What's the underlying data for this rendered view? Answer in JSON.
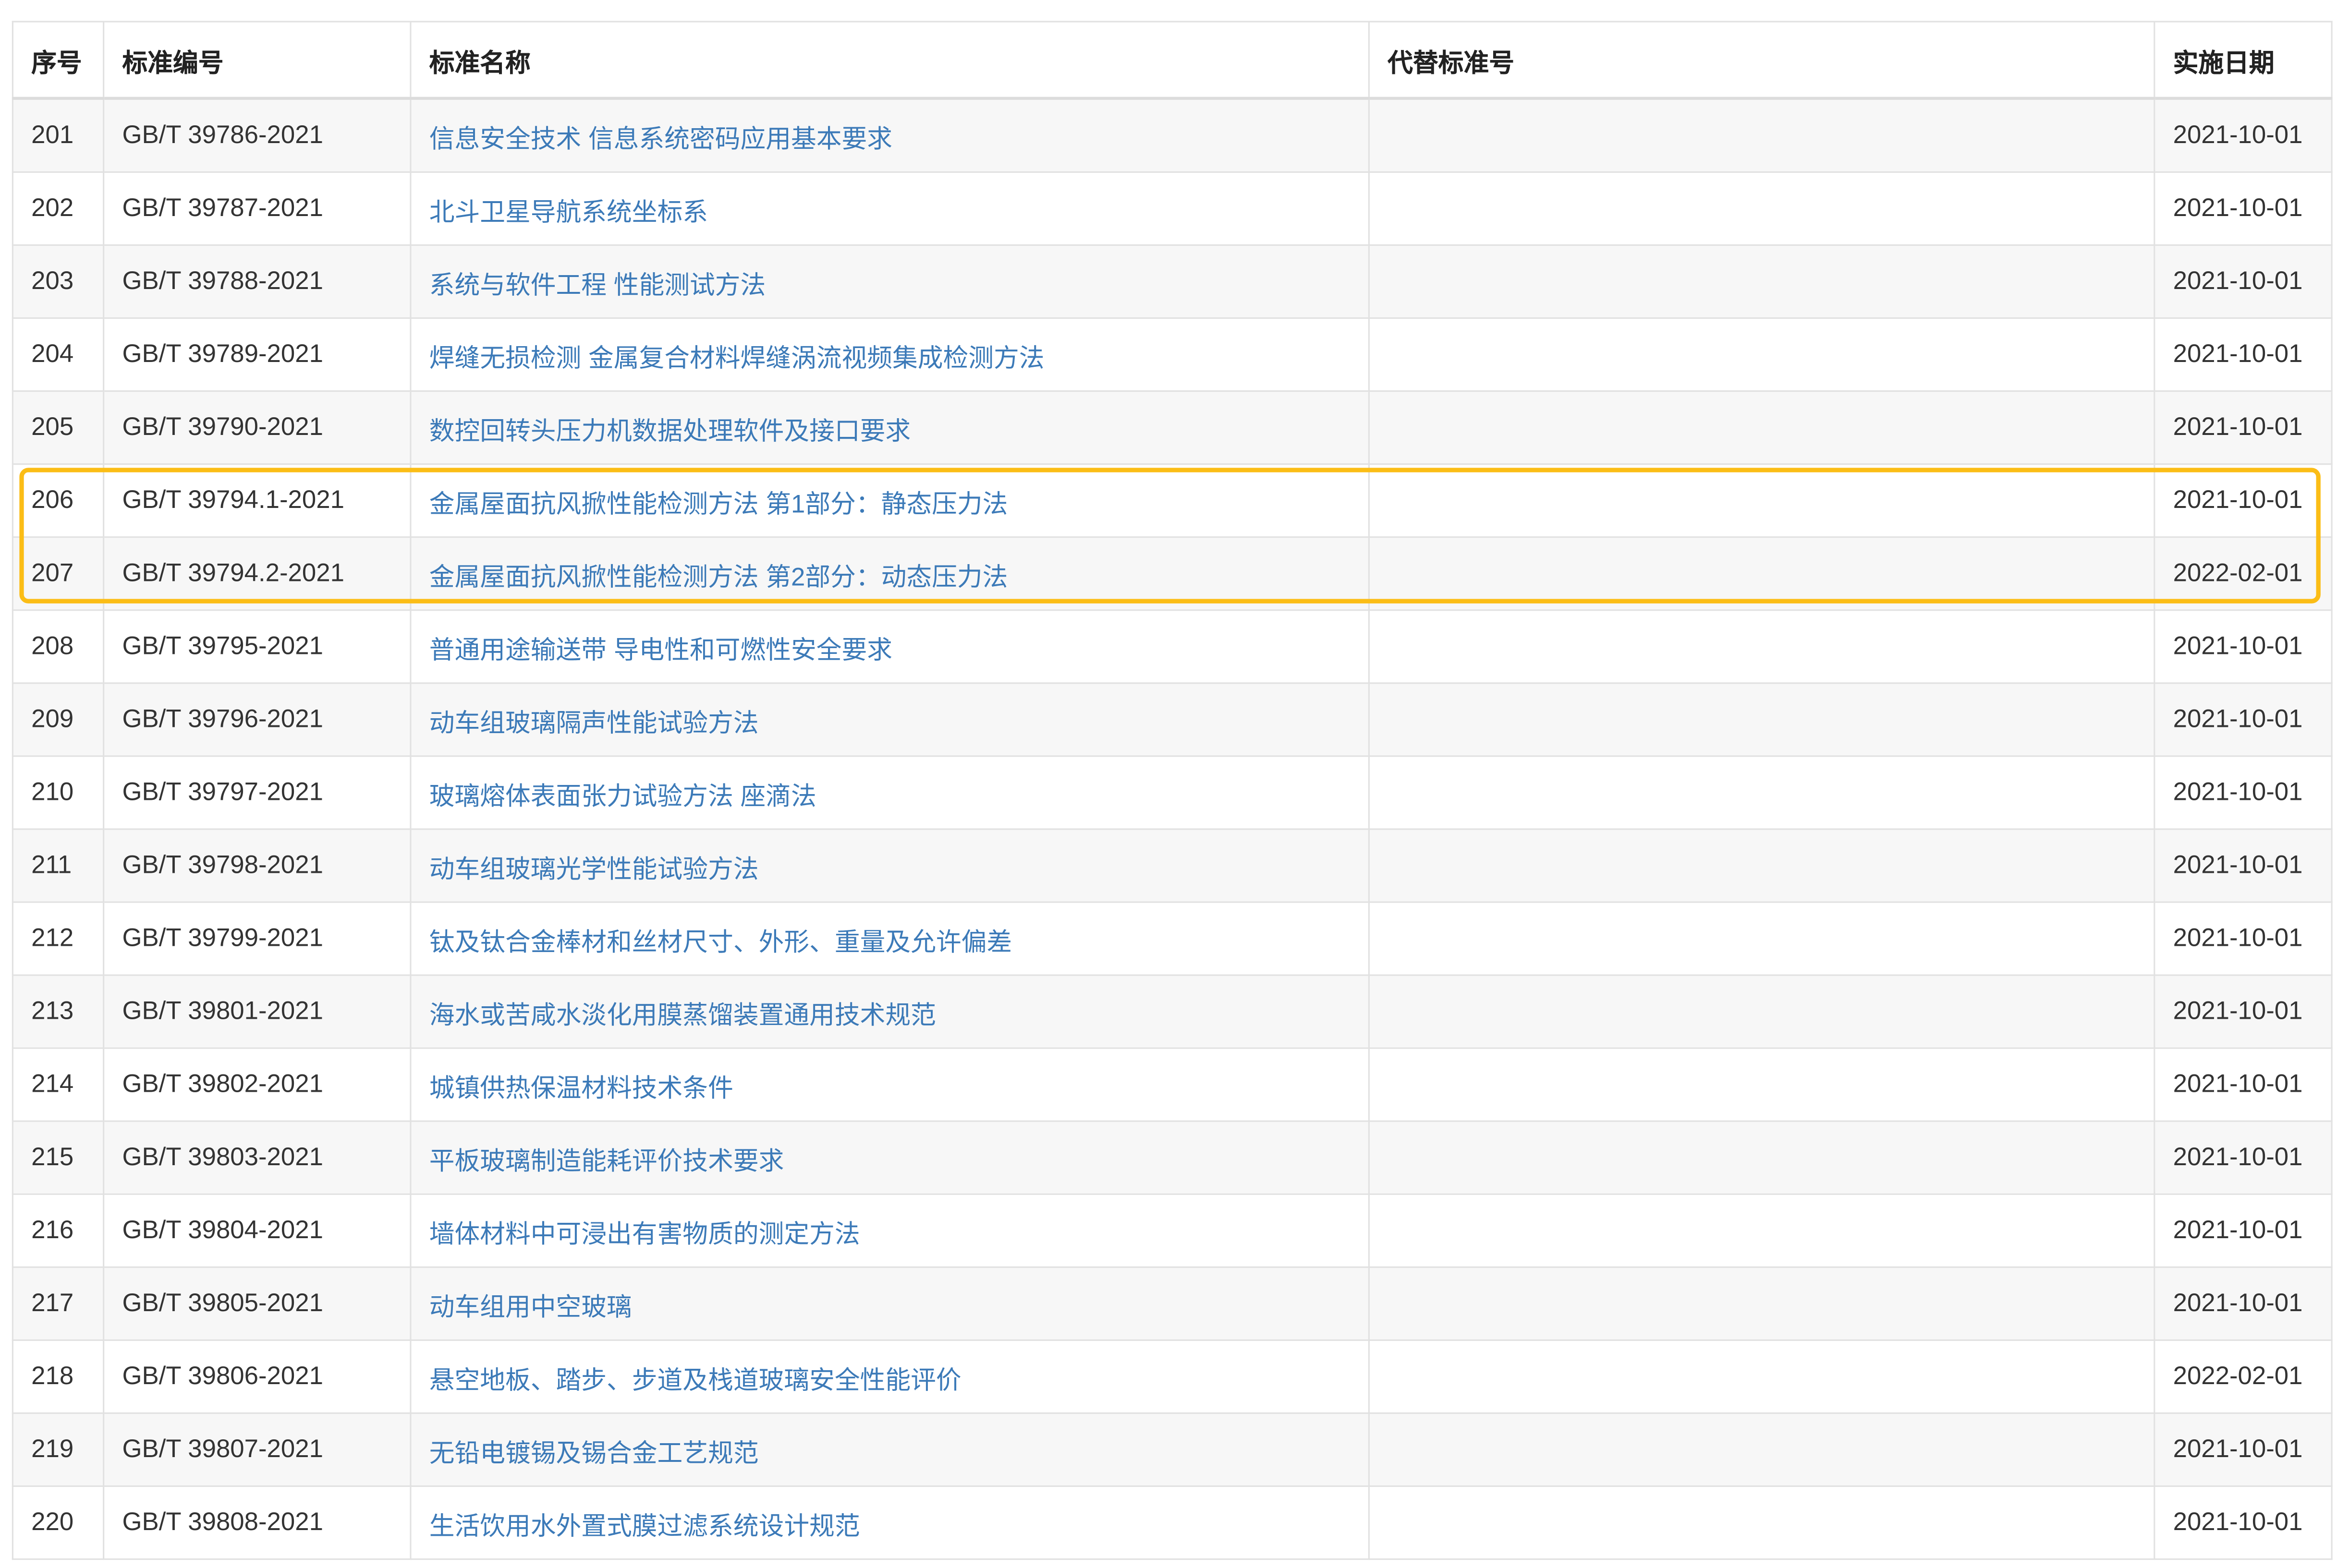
{
  "table": {
    "headers": {
      "seq": "序号",
      "code": "标准编号",
      "name": "标准名称",
      "replaces": "代替标准号",
      "date": "实施日期"
    },
    "rows": [
      {
        "seq": "201",
        "code": "GB/T 39786-2021",
        "name": "信息安全技术 信息系统密码应用基本要求",
        "replaces": "",
        "date": "2021-10-01"
      },
      {
        "seq": "202",
        "code": "GB/T 39787-2021",
        "name": "北斗卫星导航系统坐标系",
        "replaces": "",
        "date": "2021-10-01"
      },
      {
        "seq": "203",
        "code": "GB/T 39788-2021",
        "name": "系统与软件工程 性能测试方法",
        "replaces": "",
        "date": "2021-10-01"
      },
      {
        "seq": "204",
        "code": "GB/T 39789-2021",
        "name": "焊缝无损检测 金属复合材料焊缝涡流视频集成检测方法",
        "replaces": "",
        "date": "2021-10-01"
      },
      {
        "seq": "205",
        "code": "GB/T 39790-2021",
        "name": "数控回转头压力机数据处理软件及接口要求",
        "replaces": "",
        "date": "2021-10-01"
      },
      {
        "seq": "206",
        "code": "GB/T 39794.1-2021",
        "name": "金属屋面抗风掀性能检测方法 第1部分：静态压力法",
        "replaces": "",
        "date": "2021-10-01"
      },
      {
        "seq": "207",
        "code": "GB/T 39794.2-2021",
        "name": "金属屋面抗风掀性能检测方法 第2部分：动态压力法",
        "replaces": "",
        "date": "2022-02-01"
      },
      {
        "seq": "208",
        "code": "GB/T 39795-2021",
        "name": "普通用途输送带 导电性和可燃性安全要求",
        "replaces": "",
        "date": "2021-10-01"
      },
      {
        "seq": "209",
        "code": "GB/T 39796-2021",
        "name": "动车组玻璃隔声性能试验方法",
        "replaces": "",
        "date": "2021-10-01"
      },
      {
        "seq": "210",
        "code": "GB/T 39797-2021",
        "name": "玻璃熔体表面张力试验方法 座滴法",
        "replaces": "",
        "date": "2021-10-01"
      },
      {
        "seq": "211",
        "code": "GB/T 39798-2021",
        "name": "动车组玻璃光学性能试验方法",
        "replaces": "",
        "date": "2021-10-01"
      },
      {
        "seq": "212",
        "code": "GB/T 39799-2021",
        "name": "钛及钛合金棒材和丝材尺寸、外形、重量及允许偏差",
        "replaces": "",
        "date": "2021-10-01"
      },
      {
        "seq": "213",
        "code": "GB/T 39801-2021",
        "name": "海水或苦咸水淡化用膜蒸馏装置通用技术规范",
        "replaces": "",
        "date": "2021-10-01"
      },
      {
        "seq": "214",
        "code": "GB/T 39802-2021",
        "name": "城镇供热保温材料技术条件",
        "replaces": "",
        "date": "2021-10-01"
      },
      {
        "seq": "215",
        "code": "GB/T 39803-2021",
        "name": "平板玻璃制造能耗评价技术要求",
        "replaces": "",
        "date": "2021-10-01"
      },
      {
        "seq": "216",
        "code": "GB/T 39804-2021",
        "name": "墙体材料中可浸出有害物质的测定方法",
        "replaces": "",
        "date": "2021-10-01"
      },
      {
        "seq": "217",
        "code": "GB/T 39805-2021",
        "name": "动车组用中空玻璃",
        "replaces": "",
        "date": "2021-10-01"
      },
      {
        "seq": "218",
        "code": "GB/T 39806-2021",
        "name": "悬空地板、踏步、步道及栈道玻璃安全性能评价",
        "replaces": "",
        "date": "2022-02-01"
      },
      {
        "seq": "219",
        "code": "GB/T 39807-2021",
        "name": "无铅电镀锡及锡合金工艺规范",
        "replaces": "",
        "date": "2021-10-01"
      },
      {
        "seq": "220",
        "code": "GB/T 39808-2021",
        "name": "生活饮用水外置式膜过滤系统设计规范",
        "replaces": "",
        "date": "2021-10-01"
      }
    ]
  },
  "colors": {
    "link": "#3c7ab8",
    "highlight": "#fbbd16",
    "stripe": "#f7f7f7"
  }
}
